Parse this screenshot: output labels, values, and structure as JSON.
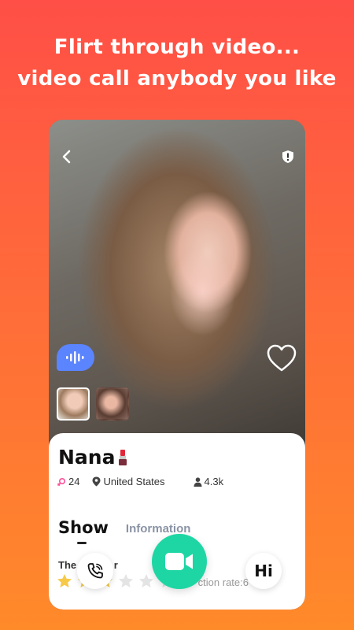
{
  "headline": {
    "line1": "Flirt through video...",
    "line2": "video call anybody you like"
  },
  "profile": {
    "name": "Nana",
    "age": "24",
    "location": "United States",
    "followers": "4.3k"
  },
  "tabs": {
    "show": "Show",
    "information": "Information"
  },
  "show_section": {
    "description_partial": "The      vs she r",
    "stars_filled": 3,
    "stars_total": 6,
    "rate_partial": "ction rate:6"
  },
  "actions": {
    "hi_label": "Hi"
  },
  "colors": {
    "accent_green": "#1ed6a4",
    "voice_blue": "#5b84ff",
    "star_gold": "#f7c948",
    "gender_pink": "#ff4f9a"
  },
  "icons": [
    "back-icon",
    "shield-icon",
    "voice-icon",
    "heart-icon",
    "lipstick-icon",
    "gender-icon",
    "location-pin-icon",
    "person-icon",
    "star-icon",
    "phone-icon",
    "video-camera-icon"
  ]
}
